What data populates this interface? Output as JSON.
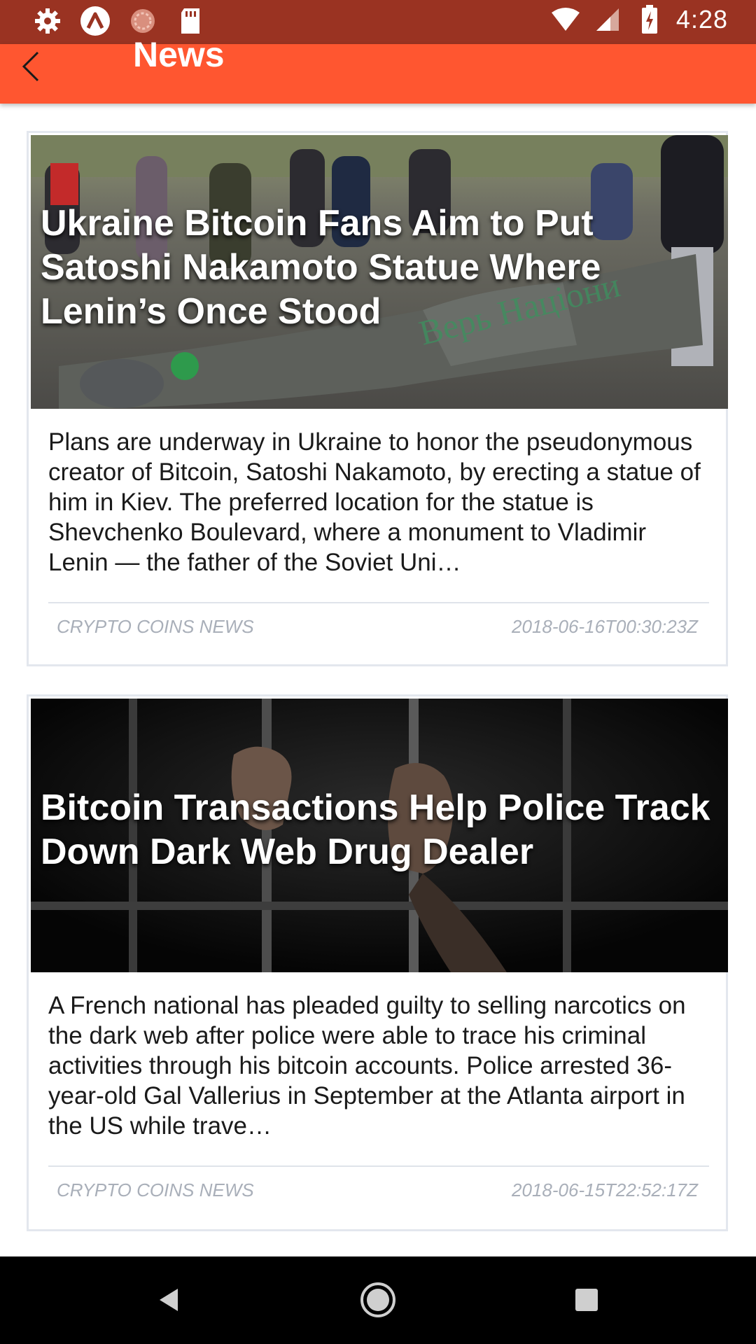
{
  "status_bar": {
    "time": "4:28",
    "icons_left": [
      "gear-icon",
      "a-circle-icon",
      "sync-icon",
      "sd-card-icon"
    ],
    "icons_right": [
      "wifi-icon",
      "signal-icon",
      "battery-icon"
    ]
  },
  "app_bar": {
    "title": "News",
    "back_icon": "chevron-left-icon"
  },
  "articles": [
    {
      "title": "Ukraine Bitcoin Fans Aim to Put Satoshi Nakamoto Statue Where Lenin’s Once Stood",
      "description": "Plans are underway in Ukraine to honor the pseudonymous creator of Bitcoin, Satoshi Nakamoto, by erecting a statue of him in Kiev. The preferred location for the statue is Shevchenko Boulevard, where a monument to Vladimir Lenin — the father of the Soviet Uni…",
      "source": "CRYPTO COINS NEWS",
      "date": "2018-06-16T00:30:23Z"
    },
    {
      "title": "Bitcoin Transactions Help Police Track Down Dark Web Drug Dealer",
      "description": "A French national has pleaded guilty to selling narcotics on the dark web after police were able to trace his criminal activities through his bitcoin accounts. Police arrested 36-year-old Gal Vallerius in September at the Atlanta airport in the US while trave…",
      "source": "CRYPTO COINS NEWS",
      "date": "2018-06-15T22:52:17Z"
    }
  ],
  "nav_bar": {
    "icons": [
      "back-triangle-icon",
      "home-circle-icon",
      "recents-square-icon"
    ]
  },
  "colors": {
    "status_bar": "#9a3322",
    "app_bar": "#ff5630",
    "card_border": "#e3e7ee",
    "meta_text": "#a9afb9"
  }
}
